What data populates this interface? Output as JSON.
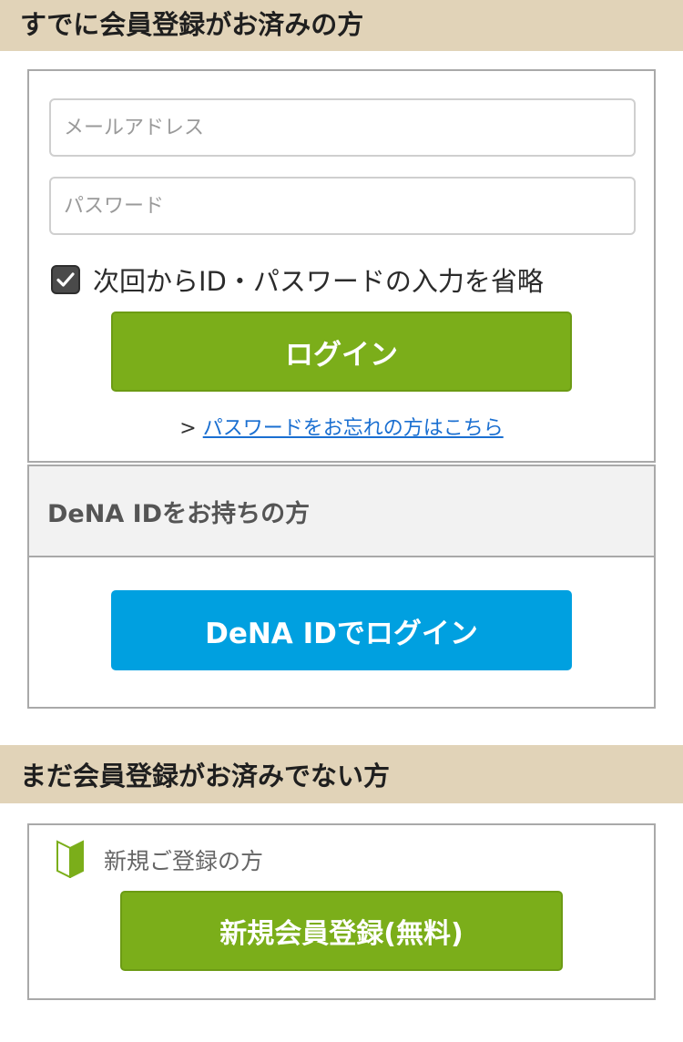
{
  "member_section": {
    "title": "すでに会員登録がお済みの方",
    "email_placeholder": "メールアドレス",
    "password_placeholder": "パスワード",
    "remember_label": "次回からID・パスワードの入力を省略",
    "remember_checked": true,
    "login_label": "ログイン",
    "forgot_prefix": ">",
    "forgot_link": "パスワードをお忘れの方はこちら"
  },
  "dena_section": {
    "title": "DeNA IDをお持ちの方",
    "login_label": "DeNA IDでログイン"
  },
  "nonmember_section": {
    "title": "まだ会員登録がお済みでない方",
    "new_user_label": "新規ご登録の方",
    "register_label": "新規会員登録(無料)"
  },
  "colors": {
    "header_bg": "#e1d3b8",
    "green_button": "#7bae1a",
    "blue_button": "#00a0e0",
    "link": "#1a6fd1"
  },
  "icons": {
    "checkbox": "checkmark-icon",
    "beginner": "beginner-mark-icon"
  }
}
